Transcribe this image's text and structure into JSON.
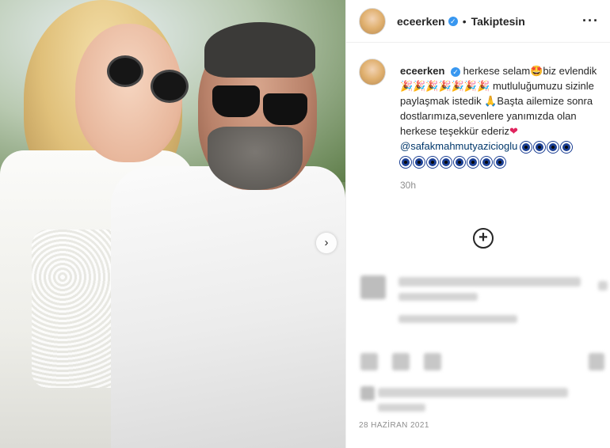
{
  "post": {
    "username": "eceerken",
    "follow_status": "Takiptesin",
    "separator": "•",
    "more_icon": "more-horizontal-icon",
    "caption_parts": {
      "p1": "herkese selam",
      "p2": "biz evlendik",
      "p3": "mutluluğumuzu sizinle paylaşmak istedik",
      "p4": "Başta ailemize sonra dostlarımıza,sevenlere yanımızda olan herkese teşekkür ederiz",
      "mention": "@safakmahmutyazicioglu"
    },
    "time_ago": "30h",
    "date": "28 HAZİRAN 2021"
  },
  "colors": {
    "verified": "#3897f0",
    "mention": "#00376b",
    "muted": "#8e8e8e"
  }
}
